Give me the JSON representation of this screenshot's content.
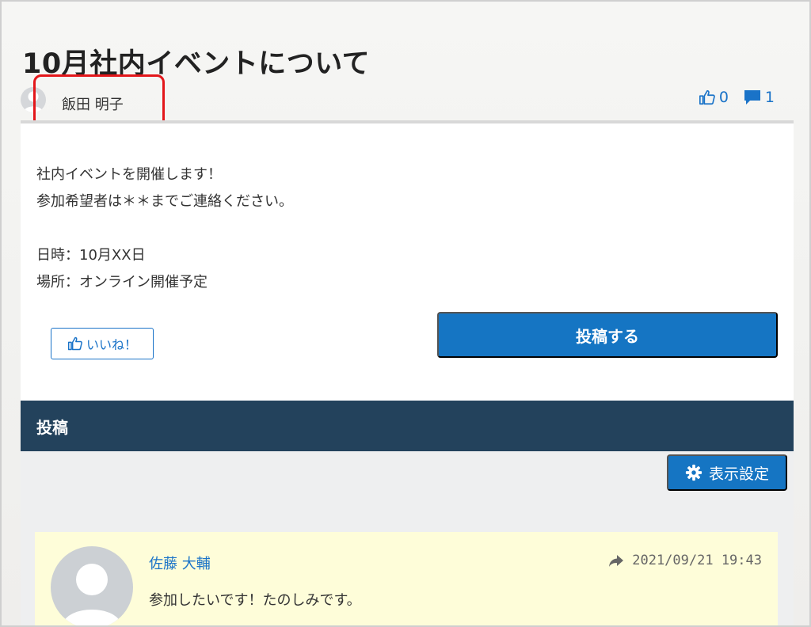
{
  "post": {
    "title": "10月社内イベントについて",
    "author": "飯田 明子",
    "like_count": "0",
    "comment_count": "1",
    "body_lines": [
      "社内イベントを開催します！",
      "参加希望者は＊＊までご連絡ください。",
      "",
      "日時：10月XX日",
      "場所：オンライン開催予定"
    ],
    "like_button_label": "いいね！",
    "post_button_label": "投稿する"
  },
  "comments_section": {
    "header": "投稿",
    "settings_button_label": "表示設定",
    "comments": [
      {
        "author": "佐藤 大輔",
        "timestamp": "2021/09/21 19:43",
        "text": "参加したいです！たのしみです。"
      }
    ]
  },
  "colors": {
    "accent": "#1575c3",
    "header_bg": "#23425c",
    "highlight": "#e3161a",
    "comment_bg": "#fefdd9"
  }
}
